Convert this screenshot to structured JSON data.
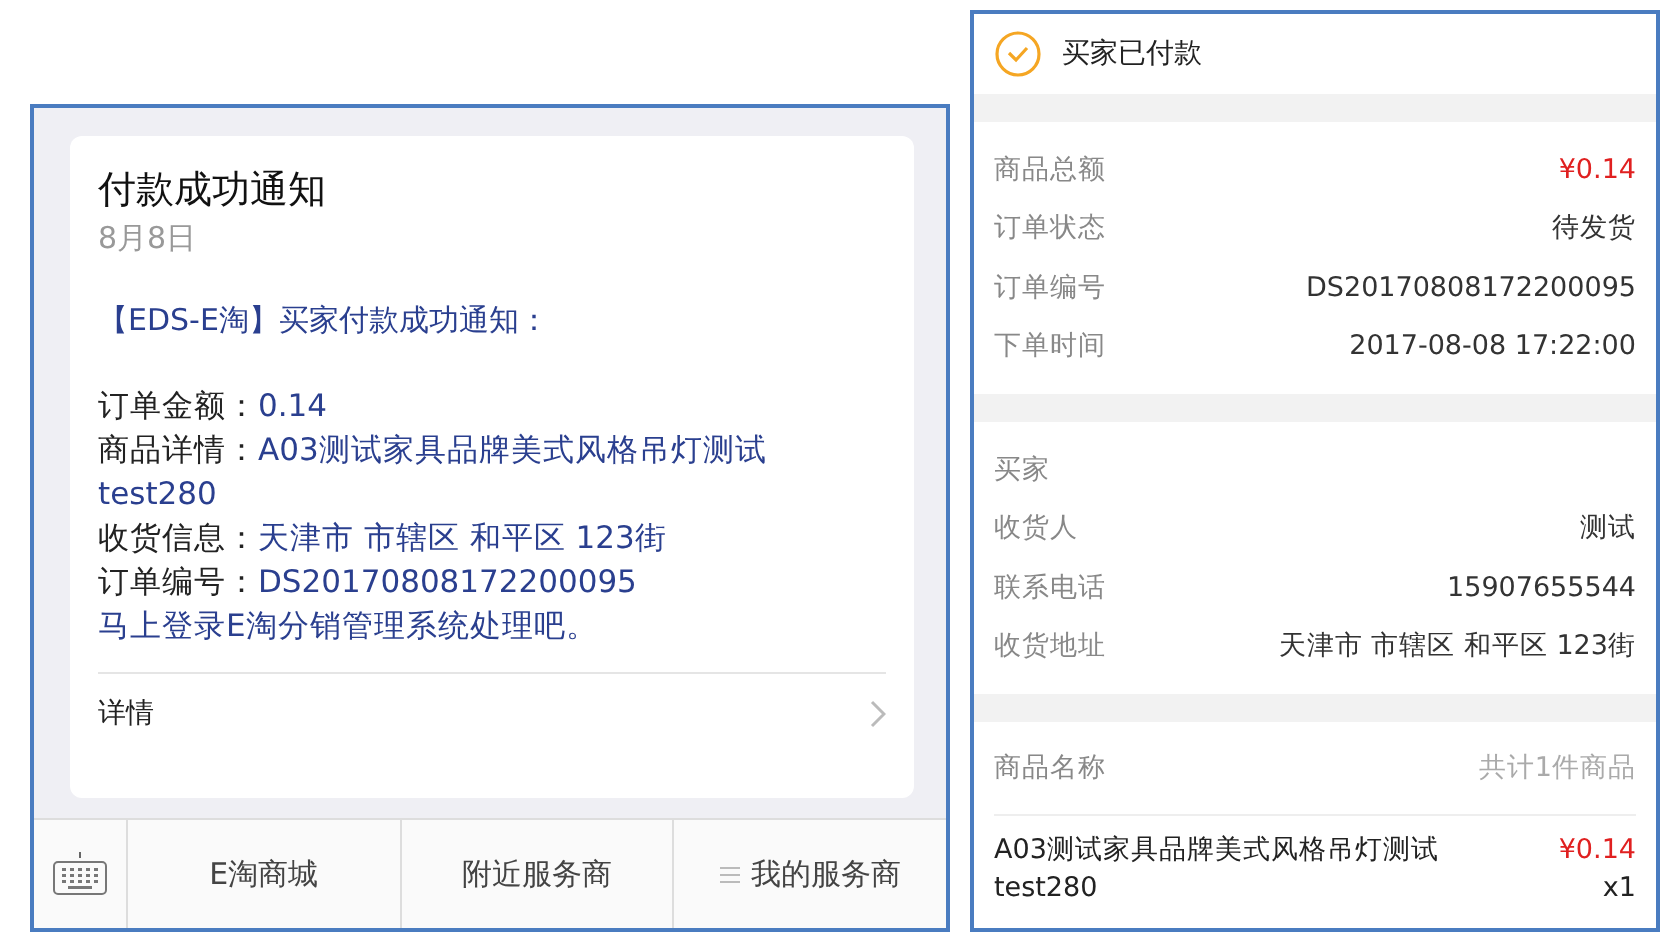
{
  "message_card": {
    "title": "付款成功通知",
    "date": "8月8日",
    "headline": "【EDS-E淘】买家付款成功通知：",
    "fields": [
      {
        "label": "订单金额：",
        "value_lines": [
          "0.14"
        ]
      },
      {
        "label": "商品详情：",
        "value_lines": [
          "A03测试家具品牌美式风格吊灯测试",
          "test280"
        ]
      },
      {
        "label": "收货信息：",
        "value_lines": [
          "天津市 市辖区 和平区 123街"
        ]
      },
      {
        "label": "订单编号：",
        "value_lines": [
          "DS20170808172200095"
        ]
      }
    ],
    "footer_note": "马上登录E淘分销管理系统处理吧。",
    "details_link": "详情"
  },
  "menu_bar": [
    {
      "label": "E淘商城",
      "kind": "plain"
    },
    {
      "label": "附近服务商",
      "kind": "plain"
    },
    {
      "label": "我的服务商",
      "kind": "submenu"
    }
  ],
  "order": {
    "status": "买家已付款",
    "sections": [
      [
        {
          "label": "商品总额",
          "value": "¥0.14",
          "kind": "price"
        },
        {
          "label": "订单状态",
          "value": "待发货",
          "kind": "plain"
        },
        {
          "label": "订单编号",
          "value": "DS20170808172200095",
          "kind": "plain"
        },
        {
          "label": "下单时间",
          "value": "2017-08-08 17:22:00",
          "kind": "plain"
        }
      ],
      [
        {
          "label": "买家",
          "kind": "header"
        },
        {
          "label": "收货人",
          "value": "测试",
          "kind": "plain"
        },
        {
          "label": "联系电话",
          "value": "15907655544",
          "kind": "plain"
        },
        {
          "label": "收货地址",
          "value": "天津市 市辖区 和平区 123街",
          "kind": "plain"
        }
      ]
    ],
    "goods_header": {
      "label": "商品名称",
      "count": "共计1件商品"
    },
    "goods": [
      {
        "name": "A03测试家具品牌美式风格吊灯测试",
        "name_2": "test280",
        "price": "¥0.14",
        "quantity": "x1"
      }
    ]
  }
}
